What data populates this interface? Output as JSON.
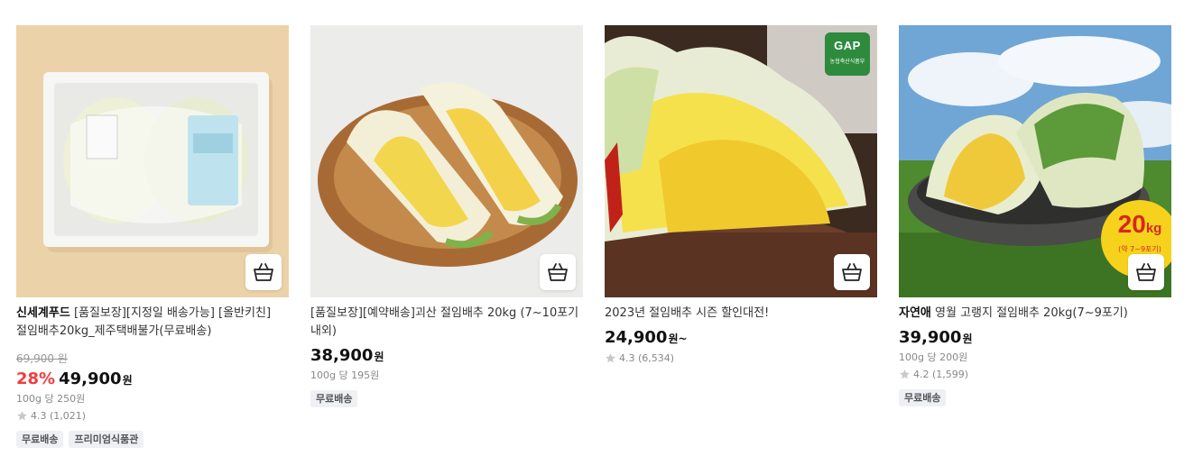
{
  "products": [
    {
      "brand": "신세계푸드",
      "title": " [품질보장][지정일 배송가능] [올반키친] 절임배추20kg_제주택배불가(무료배송)",
      "original_price": "69,900 원",
      "discount_rate": "28%",
      "price": "49,900",
      "currency": "원",
      "unit_price": "100g 당 250원",
      "rating": "4.3 (1,021)",
      "tags": [
        "무료배송",
        "프리미엄식품관"
      ],
      "icon": "cart-icon"
    },
    {
      "brand": "",
      "title": "[품질보장][예약배송]괴산 절임배추 20kg (7~10포기 내외)",
      "price": "38,900",
      "currency": "원",
      "unit_price": "100g 당 195원",
      "tags": [
        "무료배송"
      ],
      "icon": "cart-icon"
    },
    {
      "brand": "",
      "title": "2023년 절임배추 시즌 할인대전!",
      "price": "24,900",
      "currency": "원~",
      "rating": "4.3 (6,534)",
      "badge": "GAP",
      "badge_sub": "농협축산식품부",
      "icon": "cart-icon"
    },
    {
      "brand": "자연애",
      "title": " 영월 고랭지 절임배추 20kg(7~9포기)",
      "price": "39,900",
      "currency": "원",
      "unit_price": "100g 당 200원",
      "rating": "4.2 (1,599)",
      "badge": "20",
      "badge_unit": "kg",
      "badge_sub": "(약 7~9포기)",
      "tags": [
        "무료배송"
      ],
      "icon": "cart-icon"
    }
  ],
  "colors": {
    "discount": "#f03e3e",
    "tag_bg": "#eef0f4",
    "star": "#c8c8c8"
  }
}
